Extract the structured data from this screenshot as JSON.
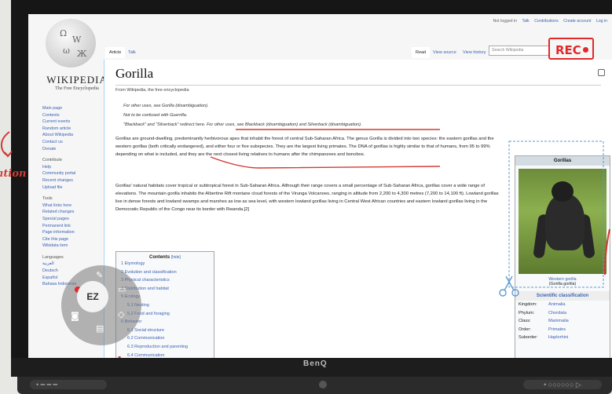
{
  "device": {
    "brand": "BenQ",
    "base_left": "•  ━ ━ ━",
    "base_right": "• ○○○○○○ ▷"
  },
  "annotation": {
    "rec_label": "REC",
    "side_word": "ation",
    "wheel_center": "EZ"
  },
  "top_links": {
    "status": "Not logged in",
    "talk": "Talk",
    "contributions": "Contributions",
    "create": "Create account",
    "login": "Log in"
  },
  "tabs": {
    "article": "Article",
    "talk": "Talk",
    "read": "Read",
    "view_source": "View source",
    "view_history": "View history",
    "search_placeholder": "Search Wikipedia"
  },
  "logo": {
    "wordmark": "Wikipedia",
    "tagline": "The Free Encyclopedia"
  },
  "sidebar": {
    "nav": [
      "Main page",
      "Contents",
      "Current events",
      "Random article",
      "About Wikipedia",
      "Contact us",
      "Donate"
    ],
    "contribute_heading": "Contribute",
    "contribute": [
      "Help",
      "Community portal",
      "Recent changes",
      "Upload file"
    ],
    "tools_heading": "Tools",
    "tools": [
      "What links here",
      "Related changes",
      "Special pages",
      "Permanent link",
      "Page information",
      "Cite this page",
      "Wikidata item"
    ],
    "languages_heading": "Languages",
    "languages": [
      "العربية",
      "Deutsch",
      "Español",
      "Bahasa Indonesia"
    ]
  },
  "article": {
    "title": "Gorilla",
    "from": "From Wikipedia, the free encyclopedia",
    "hat1": "For other uses, see Gorilla (disambiguation).",
    "hat2": "Not to be confused with Guerrilla.",
    "hat3": "\"Blackback\" and \"Silverback\" redirect here. For other uses, see Blackback (disambiguation) and Silverback (disambiguation).",
    "p1": "Gorillas are ground-dwelling, predominantly herbivorous apes that inhabit the forest of central Sub-Saharan Africa. The genus Gorilla is divided into two species: the eastern gorillas and the western gorillas (both critically endangered), and either four or five subspecies. They are the largest living primates. The DNA of gorillas is highly similar to that of humans, from 95 to 99% depending on what is included, and they are the next closest living relatives to humans after the chimpanzees and bonobos.",
    "p2": "Gorillas' natural habitats cover tropical or subtropical forest in Sub-Saharan Africa. Although their range covers a small percentage of Sub-Saharan Africa, gorillas cover a wide range of elevations. The mountain gorilla inhabits the Albertine Rift montane cloud forests of the Virunga Volcanoes, ranging in altitude from 2,200 to 4,300 metres (7,200 to 14,100 ft). Lowland gorillas live in dense forests and lowland swamps and marshes as low as sea level, with western lowland gorillas living in Central West African countries and eastern lowland gorillas living in the Democratic Republic of the Congo near its border with Rwanda.[2]"
  },
  "toc": {
    "title": "Contents",
    "hide": "[hide]",
    "items": [
      "1 Etymology",
      "2 Evolution and classification",
      "3 Physical characteristics",
      "4 Distribution and habitat",
      "5 Ecology",
      "5.1 Nesting",
      "5.2 Food and foraging",
      "6 Behavior",
      "6.1 Social structure",
      "6.2 Communication",
      "6.3 Reproduction and parenting",
      "6.4 Communication"
    ]
  },
  "infobox": {
    "title": "Gorillas",
    "caption": "Western gorilla",
    "caption2": "(Gorilla gorilla)",
    "section": "Scientific classification",
    "rows": [
      {
        "k": "Kingdom:",
        "v": "Animalia"
      },
      {
        "k": "Phylum:",
        "v": "Chordata"
      },
      {
        "k": "Class:",
        "v": "Mammalia"
      },
      {
        "k": "Order:",
        "v": "Primates"
      },
      {
        "k": "Suborder:",
        "v": "Haplorhini"
      }
    ]
  }
}
